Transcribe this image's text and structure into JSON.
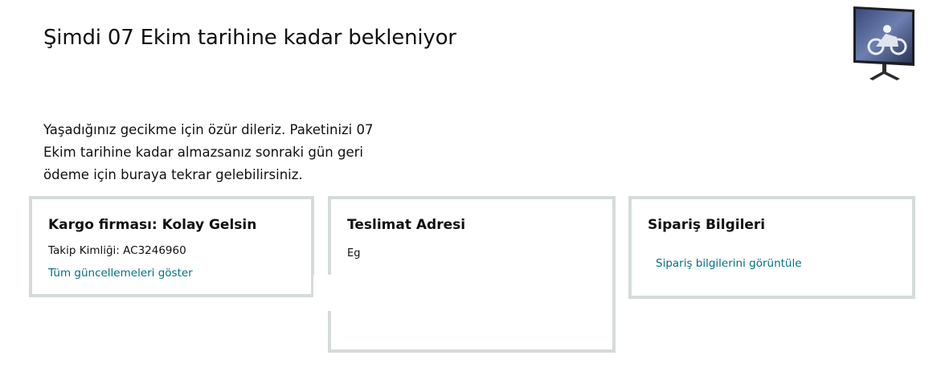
{
  "headline": "Şimdi 07 Ekim tarihine kadar bekleniyor",
  "apology_text": "Yaşadığınız gecikme için özür dileriz. Paketinizi 07 Ekim tarihine kadar almazsanız sonraki gün geri ödeme için buraya tekrar gelebilirsiniz.",
  "shipping": {
    "title": "Kargo firması: Kolay Gelsin",
    "tracking_label": "Takip Kimliği: ",
    "tracking_id": "AC3246960",
    "updates_link": "Tüm güncellemeleri göster"
  },
  "address": {
    "title": "Teslimat Adresi",
    "name_partial": "Eg"
  },
  "order": {
    "title": "Sipariş Bilgileri",
    "details_link": "Sipariş bilgilerini görüntüle"
  },
  "product_image": {
    "icon": "monitor-product-image"
  },
  "colors": {
    "link": "#007185",
    "card_border": "#d5dbdb",
    "text": "#0f1111"
  }
}
